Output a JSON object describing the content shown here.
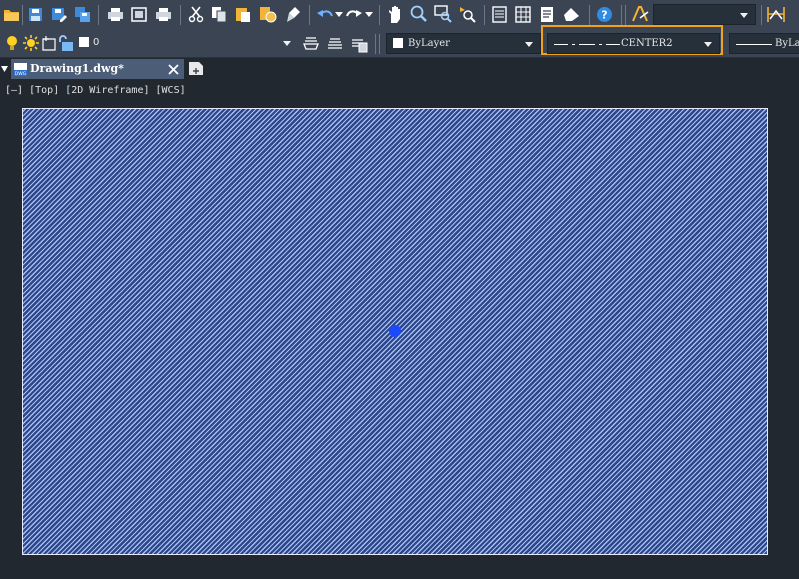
{
  "quick_access_toolbar": {
    "icons": [
      "open-icon",
      "save-icon",
      "save-as-icon",
      "save-all-icon",
      "print-icon",
      "plot-preview-icon",
      "publish-icon",
      "cut-icon",
      "copy-icon",
      "paste-icon",
      "match-properties-icon",
      "matchprop-brush-icon",
      "undo-icon",
      "redo-icon",
      "pan-icon",
      "zoom-realtime-icon",
      "zoom-window-icon",
      "zoom-previous-icon",
      "properties-icon",
      "design-center-icon",
      "tool-palettes-icon",
      "markup-icon",
      "help-icon",
      "text-style-icon",
      "dimension-style-icon"
    ],
    "text_style_value": ""
  },
  "layer_toolbar": {
    "layer_name": "0",
    "color_value": "ByLayer",
    "linetype_value": "CENTER2",
    "lineweight_value": "ByLa",
    "highlight_color": "#f0a21b"
  },
  "document_tabs": [
    {
      "label": "Drawing1.dwg*",
      "icon": "dwg-file-icon"
    }
  ],
  "viewport": {
    "label": "[—] [Top] [2D Wireframe] [WCS]"
  },
  "drawing": {
    "object": "hatch",
    "hatch_color": "#2d4b92",
    "line_color": "#a9bef2",
    "grip_color": "#1a49ff"
  }
}
